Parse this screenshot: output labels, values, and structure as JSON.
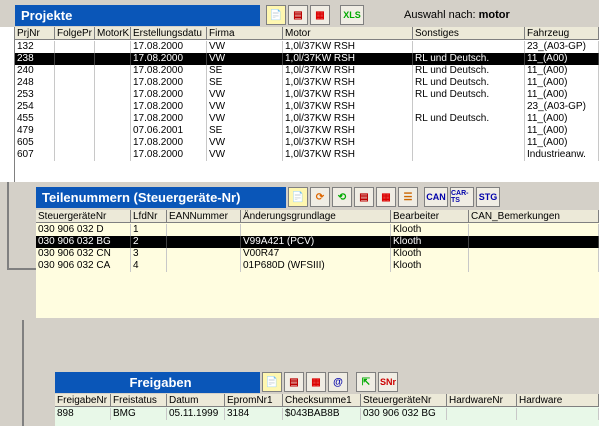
{
  "projekte": {
    "title": "Projekte",
    "toolbar": [
      {
        "icon": "new-icon"
      },
      {
        "icon": "edit-icon"
      },
      {
        "icon": "delete-icon"
      },
      {
        "icon": "xls-icon",
        "label": "XLS"
      }
    ],
    "filter_label": "Auswahl nach:",
    "filter_value": "motor",
    "columns": [
      "PrjNr",
      "FolgePr",
      "MotorK",
      "Erstellungsdatu",
      "Firma",
      "Motor",
      "Sonstiges",
      "Fahrzeug"
    ],
    "rows": [
      [
        "132",
        "",
        "",
        "17.08.2000",
        "VW",
        "1,0l/37KW RSH",
        "",
        "23_(A03-GP)"
      ],
      [
        "238",
        "",
        "",
        "17.08.2000",
        "VW",
        "1,0l/37KW RSH",
        "RL und Deutsch.",
        "11_(A00)"
      ],
      [
        "240",
        "",
        "",
        "17.08.2000",
        "SE",
        "1,0l/37KW RSH",
        "RL und Deutsch.",
        "11_(A00)"
      ],
      [
        "248",
        "",
        "",
        "17.08.2000",
        "SE",
        "1,0l/37KW RSH",
        "RL und Deutsch.",
        "11_(A00)"
      ],
      [
        "253",
        "",
        "",
        "17.08.2000",
        "VW",
        "1,0l/37KW RSH",
        "RL und Deutsch.",
        "11_(A00)"
      ],
      [
        "254",
        "",
        "",
        "17.08.2000",
        "VW",
        "1,0l/37KW RSH",
        "",
        "23_(A03-GP)"
      ],
      [
        "455",
        "",
        "",
        "17.08.2000",
        "VW",
        "1,0l/37KW RSH",
        "RL und Deutsch.",
        "11_(A00)"
      ],
      [
        "479",
        "",
        "",
        "07.06.2001",
        "SE",
        "1,0l/37KW RSH",
        "",
        "11_(A00)"
      ],
      [
        "605",
        "",
        "",
        "17.08.2000",
        "VW",
        "1,0l/37KW RSH",
        "",
        "11_(A00)"
      ],
      [
        "607",
        "",
        "",
        "17.08.2000",
        "VW",
        "1,0l/37KW RSH",
        "",
        "Industrieanw."
      ]
    ],
    "selected_row": 1
  },
  "teilenummern": {
    "title": "Teilenummern (Steuergeräte-Nr)",
    "toolbar": [
      {
        "icon": "new-icon"
      },
      {
        "icon": "refresh-icon"
      },
      {
        "icon": "copy-icon"
      },
      {
        "icon": "edit-icon"
      },
      {
        "icon": "delete-icon"
      },
      {
        "icon": "list-icon"
      },
      {
        "icon": "can-icon",
        "label": "CAN"
      },
      {
        "icon": "cars-icon",
        "label": "CAR-TS"
      },
      {
        "icon": "stg-icon",
        "label": "STG"
      }
    ],
    "columns": [
      "SteuergeräteNr",
      "LfdNr",
      "EANNummer",
      "Änderungsgrundlage",
      "Bearbeiter",
      "CAN_Bemerkungen"
    ],
    "rows": [
      [
        "030 906 032 D",
        "1",
        "",
        "",
        "Klooth",
        ""
      ],
      [
        "030 906 032 BG",
        "2",
        "",
        "V99A421 (PCV)",
        "Klooth",
        ""
      ],
      [
        "030 906 032 CN",
        "3",
        "",
        "V00R47",
        "Klooth",
        ""
      ],
      [
        "030 906 032 CA",
        "4",
        "",
        "01P680D (WFSIII)",
        "Klooth",
        ""
      ]
    ],
    "selected_row": 1
  },
  "freigaben": {
    "title": "Freigaben",
    "toolbar": [
      {
        "icon": "new-icon"
      },
      {
        "icon": "edit-icon"
      },
      {
        "icon": "delete-icon"
      },
      {
        "icon": "at-icon",
        "label": "@"
      },
      {
        "icon": "import-icon"
      },
      {
        "icon": "snr-icon",
        "label": "SNr"
      }
    ],
    "columns": [
      "FreigabeNr",
      "Freistatus",
      "Datum",
      "EpromNr1",
      "Checksumme1",
      "SteuergeräteNr",
      "HardwareNr",
      "Hardware"
    ],
    "rows": [
      [
        "898",
        "BMG",
        "05.11.1999",
        "3184",
        "$043BAB8B",
        "030 906 032 BG",
        "",
        ""
      ]
    ]
  }
}
